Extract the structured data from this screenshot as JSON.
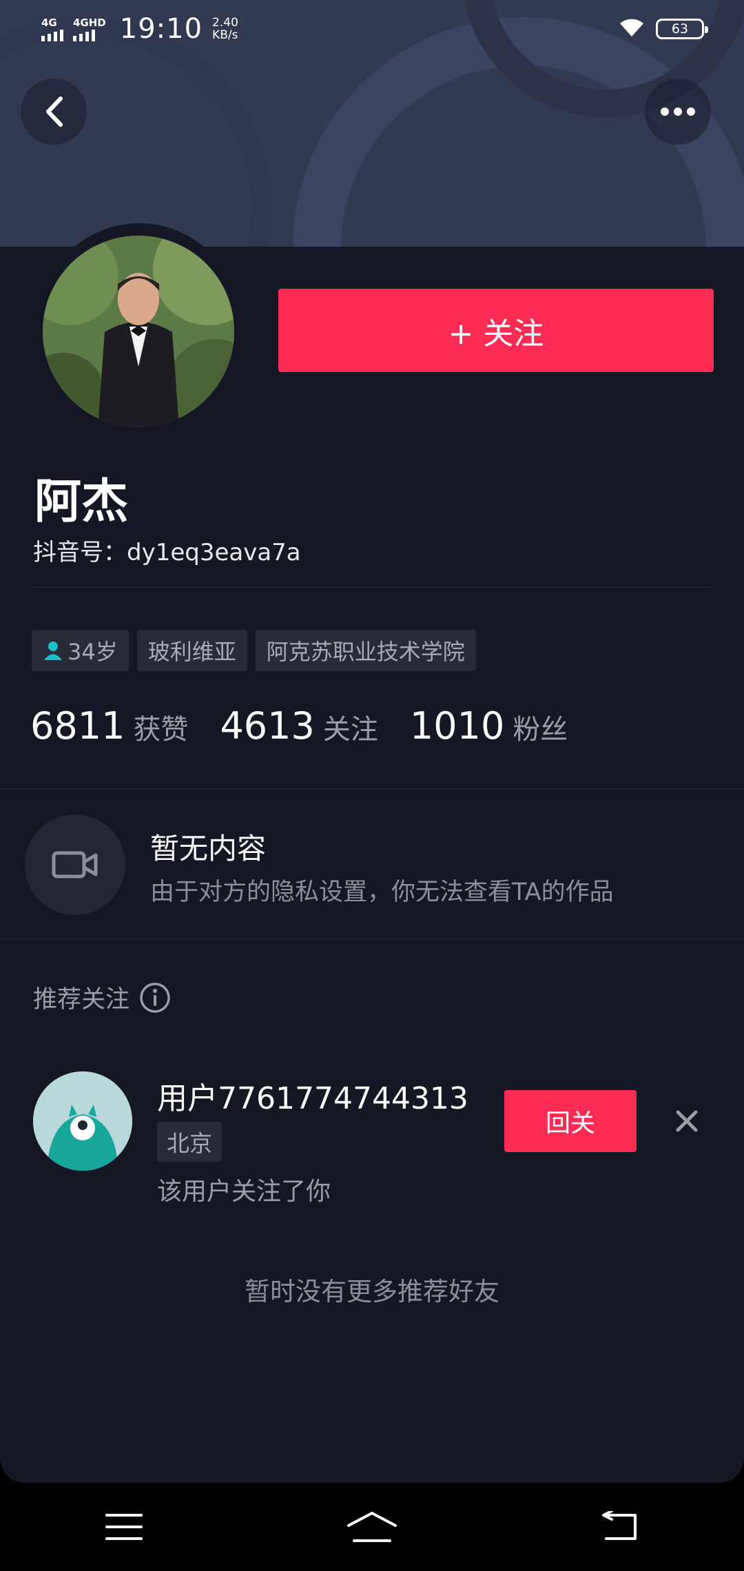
{
  "status_bar": {
    "net1": "4G",
    "net2": "4GHD",
    "time": "19:10",
    "speed_value": "2.40",
    "speed_unit": "KB/s",
    "battery": "63"
  },
  "header": {
    "back_icon": "chevron-left-icon",
    "more_icon": "ellipsis-icon"
  },
  "profile": {
    "follow_label": "+ 关注",
    "name": "阿杰",
    "douyin_id": "抖音号：dy1eq3eava7a",
    "tags": {
      "age": "34岁",
      "country": "玻利维亚",
      "school": "阿克苏职业技术学院"
    },
    "stats": [
      {
        "num": "6811",
        "label": "获赞"
      },
      {
        "num": "4613",
        "label": "关注"
      },
      {
        "num": "1010",
        "label": "粉丝"
      }
    ]
  },
  "empty_state": {
    "title": "暂无内容",
    "subtitle": "由于对方的隐私设置，你无法查看TA的作品"
  },
  "recommendations": {
    "title": "推荐关注",
    "user": {
      "name": "用户7761774744313",
      "location": "北京",
      "description": "该用户关注了你",
      "button_label": "回关"
    },
    "no_more": "暂时没有更多推荐好友"
  },
  "colors": {
    "background": "#161724",
    "accent": "#fe2c55",
    "banner": "#323a52"
  }
}
